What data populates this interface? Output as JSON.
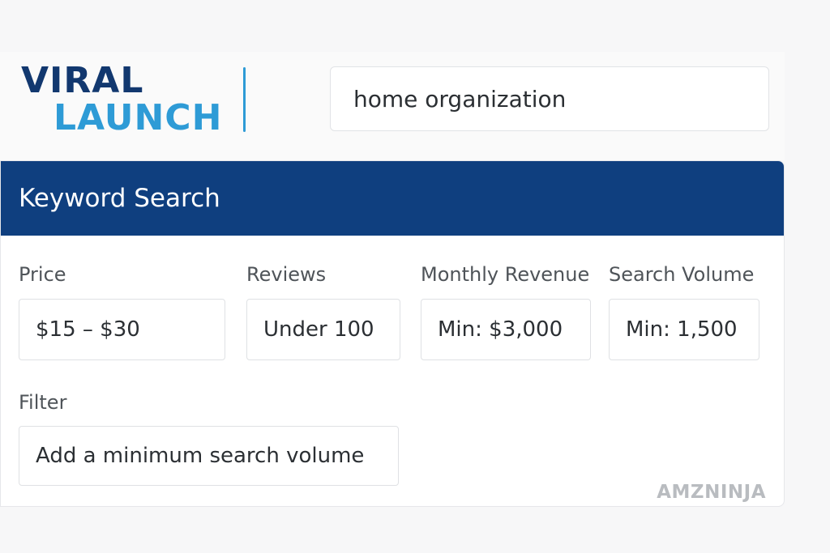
{
  "brand": {
    "line1": "VIRAL",
    "line2": "LAUNCH",
    "colors": {
      "primary": "#12386f",
      "accent": "#2e9bd6"
    }
  },
  "search": {
    "value": "home organization"
  },
  "panel": {
    "title": "Keyword Search",
    "header_color": "#0f3f7f"
  },
  "filters": [
    {
      "label": "Price",
      "value": "$15 – $30"
    },
    {
      "label": "Reviews",
      "value": "Under 100"
    },
    {
      "label": "Monthly Revenue",
      "value": "Min: $3,000"
    },
    {
      "label": "Search Volume",
      "value": "Min: 1,500"
    }
  ],
  "filter_field": {
    "label": "Filter",
    "value": "Add a minimum search volume"
  },
  "watermark": "AMZNINJA"
}
